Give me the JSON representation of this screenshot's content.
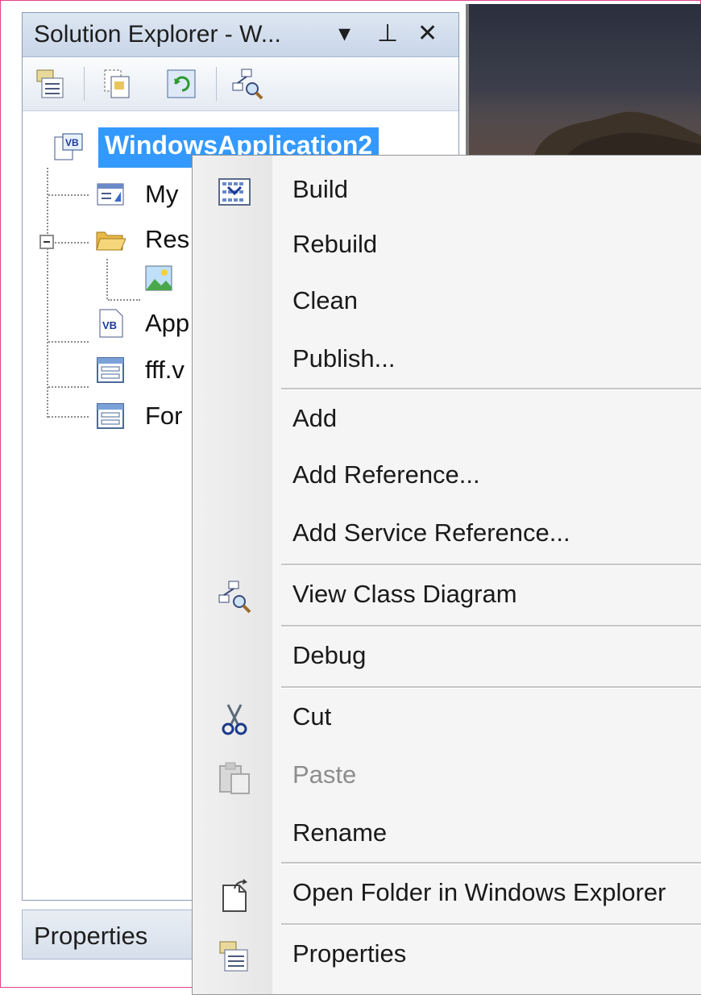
{
  "panel": {
    "title": "Solution Explorer - W...",
    "dropdown_glyph": "▾",
    "pin_glyph": "⊥",
    "close_glyph": "✕",
    "toolbar": [
      "properties-icon",
      "show-all-files-icon",
      "refresh-icon",
      "view-class-diagram-icon"
    ]
  },
  "tree": {
    "root": "WindowsApplication2",
    "items": [
      {
        "label": "My",
        "icon": "my-project-icon"
      },
      {
        "label": "Res",
        "icon": "folder-open-icon"
      },
      {
        "label": "",
        "icon": "image-icon"
      },
      {
        "label": "App",
        "icon": "vb-file-icon"
      },
      {
        "label": "fff.v",
        "icon": "form-icon"
      },
      {
        "label": "For",
        "icon": "form-icon"
      }
    ]
  },
  "properties_tab": {
    "label": "Properties"
  },
  "context_menu": {
    "items": [
      {
        "label": "Build",
        "icon": "build-icon"
      },
      {
        "label": "Rebuild"
      },
      {
        "label": "Clean"
      },
      {
        "label": "Publish..."
      },
      {
        "label": "Add"
      },
      {
        "label": "Add Reference..."
      },
      {
        "label": "Add Service Reference..."
      },
      {
        "label": "View Class Diagram",
        "icon": "class-diagram-icon"
      },
      {
        "label": "Debug"
      },
      {
        "label": "Cut",
        "icon": "scissors-icon"
      },
      {
        "label": "Paste",
        "icon": "paste-icon",
        "disabled": true
      },
      {
        "label": "Rename"
      },
      {
        "label": "Open Folder in Windows Explorer",
        "icon": "open-folder-icon"
      },
      {
        "label": "Properties",
        "icon": "properties-icon"
      }
    ]
  },
  "colors": {
    "selection": "#3399ff",
    "menu_bg": "#f5f5f5",
    "frame_border": "#e8428c"
  }
}
